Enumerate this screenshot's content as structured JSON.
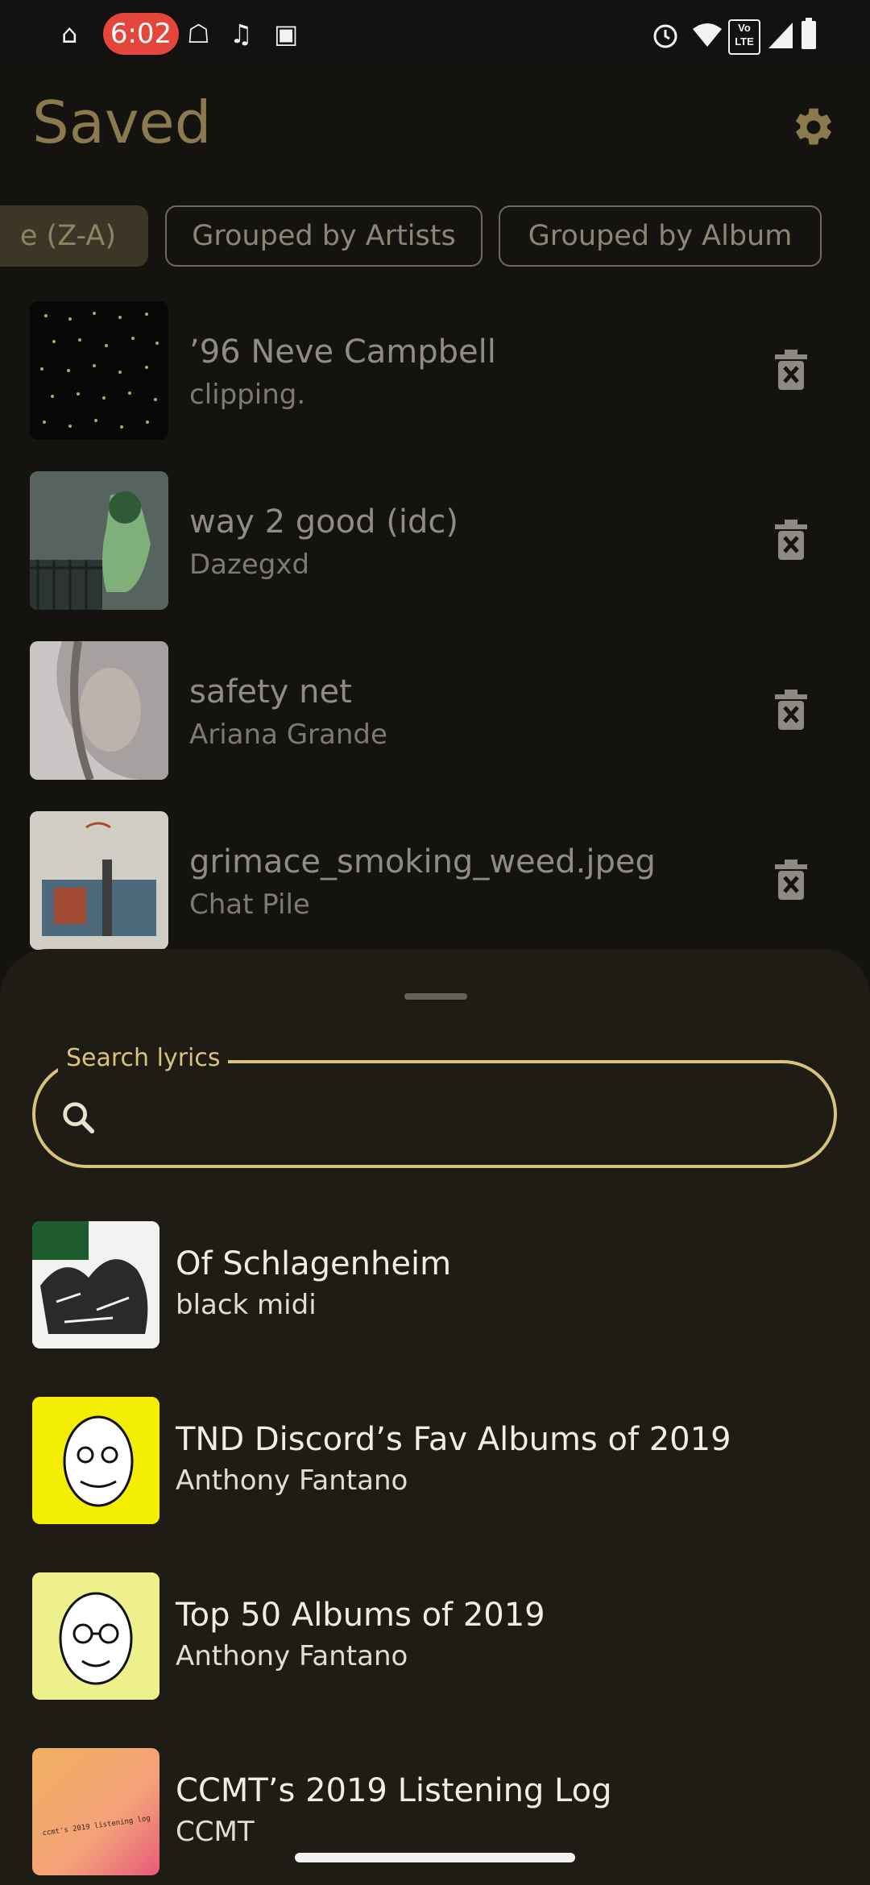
{
  "status_bar": {
    "time": "6:02",
    "left_icons": [
      "hat-icon",
      "cat-icon",
      "sync-icon",
      "sim-icon"
    ],
    "right_icons": [
      "alarm-icon",
      "wifi-icon",
      "volte-icon",
      "signal-icon",
      "battery-icon"
    ],
    "volte_label": "Vo LTE"
  },
  "header": {
    "title": "Saved",
    "settings_icon": "gear-icon"
  },
  "chips": [
    "e (Z-A)",
    "Grouped by Artists",
    "Grouped by Album"
  ],
  "saved": [
    {
      "title": "’96 Neve Campbell",
      "artist": "clipping."
    },
    {
      "title": "way 2 good (idc)",
      "artist": "Dazegxd"
    },
    {
      "title": "safety net",
      "artist": "Ariana Grande"
    },
    {
      "title": "grimace_smoking_weed.jpeg",
      "artist": "Chat Pile"
    }
  ],
  "search": {
    "label": "Search lyrics",
    "value": ""
  },
  "albums": [
    {
      "title": "Of Schlagenheim",
      "artist": "black midi"
    },
    {
      "title": "TND Discord’s Fav Albums of 2019",
      "artist": "Anthony Fantano"
    },
    {
      "title": "Top 50 Albums of 2019",
      "artist": "Anthony Fantano"
    },
    {
      "title": "CCMT’s 2019 Listening Log",
      "artist": "CCMT"
    }
  ],
  "album_art_text": {
    "ccmt": "ccmt's 2019 listening log"
  },
  "colors": {
    "accent": "#d9c27a",
    "title": "#8a7a4e",
    "sheet": "#1e1c14",
    "background": "#15130f"
  }
}
